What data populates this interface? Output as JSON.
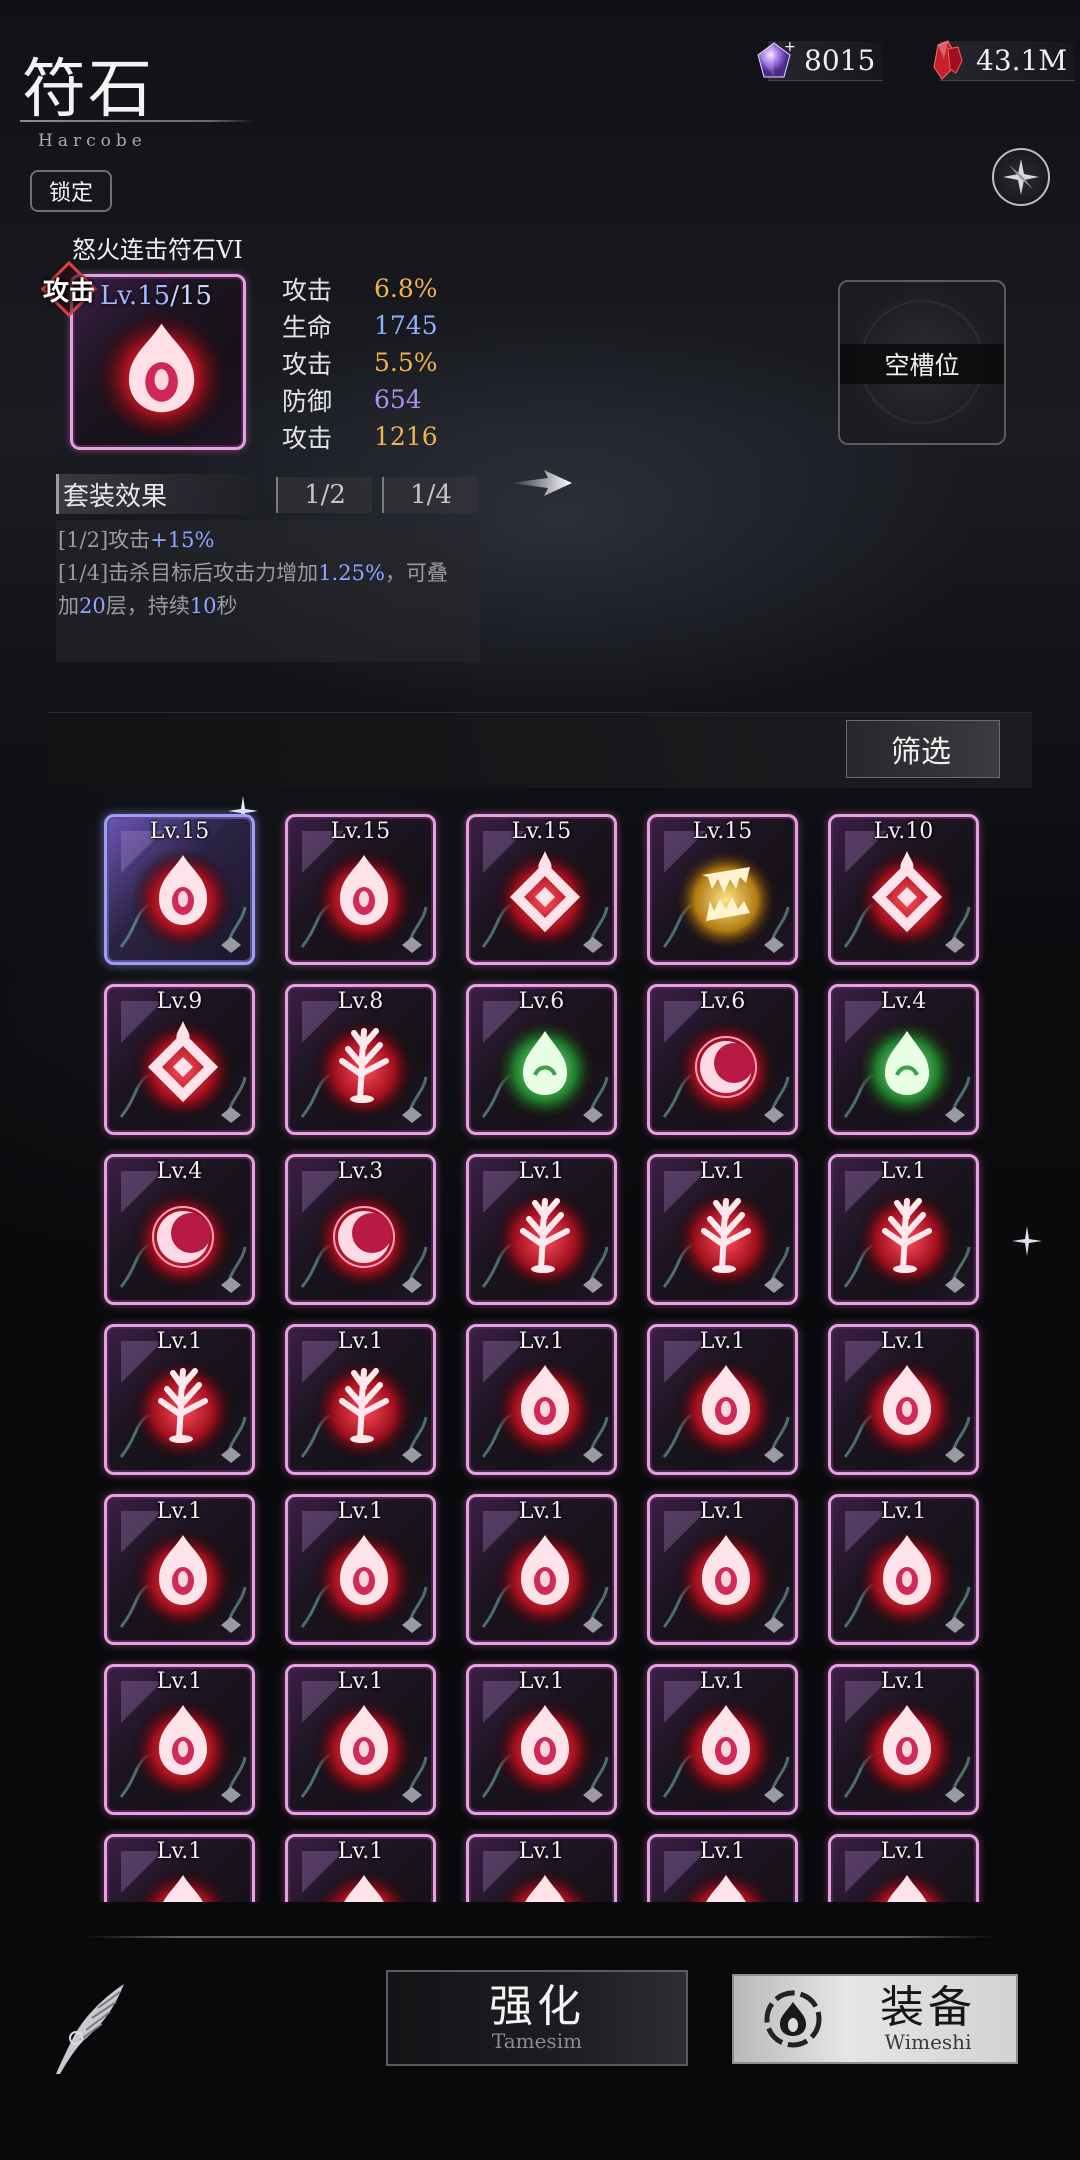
{
  "header": {
    "title": "符石",
    "subtitle": "Harcobe"
  },
  "currency": {
    "gems": "8015",
    "rubies": "43.1M"
  },
  "lock_label": "锁定",
  "selected_rune": {
    "name": "怒火连击符石VI",
    "type_badge": "攻击",
    "level_current": "Lv.15",
    "level_max": "/15",
    "icon": "flame-eye",
    "stats": [
      {
        "label": "攻击",
        "value": "6.8%",
        "color": "#f0b24a"
      },
      {
        "label": "生命",
        "value": "1745",
        "color": "#8fb0ff"
      },
      {
        "label": "攻击",
        "value": "5.5%",
        "color": "#f0b24a"
      },
      {
        "label": "防御",
        "value": "654",
        "color": "#b08cf0"
      },
      {
        "label": "攻击",
        "value": "1216",
        "color": "#f0b24a"
      }
    ]
  },
  "empty_slot_label": "空槽位",
  "set_effect": {
    "header": "套装效果",
    "tabs": [
      "1/2",
      "1/4"
    ],
    "line1_prefix": "[1/2]攻击",
    "line1_value": "+15%",
    "line2_prefix": "[1/4]击杀目标后攻击力增加",
    "line2_value": "1.25%",
    "line2_mid": "，可叠",
    "line3_prefix": "加",
    "line3_value1": "20",
    "line3_mid": "层，持续",
    "line3_value2": "10",
    "line3_suffix": "秒"
  },
  "filter_label": "筛选",
  "runes": [
    {
      "level": "Lv.15",
      "icon": "flame-eye",
      "selected": true
    },
    {
      "level": "Lv.15",
      "icon": "flame-eye"
    },
    {
      "level": "Lv.15",
      "icon": "diamond-flame"
    },
    {
      "level": "Lv.15",
      "icon": "fang-gold"
    },
    {
      "level": "Lv.10",
      "icon": "diamond-flame"
    },
    {
      "level": "Lv.9",
      "icon": "diamond-flame"
    },
    {
      "level": "Lv.8",
      "icon": "tree"
    },
    {
      "level": "Lv.6",
      "icon": "drop-green"
    },
    {
      "level": "Lv.6",
      "icon": "crescent"
    },
    {
      "level": "Lv.4",
      "icon": "drop-green"
    },
    {
      "level": "Lv.4",
      "icon": "crescent"
    },
    {
      "level": "Lv.3",
      "icon": "crescent"
    },
    {
      "level": "Lv.1",
      "icon": "tree"
    },
    {
      "level": "Lv.1",
      "icon": "tree"
    },
    {
      "level": "Lv.1",
      "icon": "tree"
    },
    {
      "level": "Lv.1",
      "icon": "tree"
    },
    {
      "level": "Lv.1",
      "icon": "tree"
    },
    {
      "level": "Lv.1",
      "icon": "flame-eye"
    },
    {
      "level": "Lv.1",
      "icon": "flame-eye"
    },
    {
      "level": "Lv.1",
      "icon": "flame-eye"
    },
    {
      "level": "Lv.1",
      "icon": "flame-eye"
    },
    {
      "level": "Lv.1",
      "icon": "flame-eye"
    },
    {
      "level": "Lv.1",
      "icon": "flame-eye"
    },
    {
      "level": "Lv.1",
      "icon": "flame-eye"
    },
    {
      "level": "Lv.1",
      "icon": "flame-eye"
    },
    {
      "level": "Lv.1",
      "icon": "flame-eye"
    },
    {
      "level": "Lv.1",
      "icon": "flame-eye"
    },
    {
      "level": "Lv.1",
      "icon": "flame-eye"
    },
    {
      "level": "Lv.1",
      "icon": "flame-eye"
    },
    {
      "level": "Lv.1",
      "icon": "flame-eye"
    },
    {
      "level": "Lv.1",
      "icon": "flame-eye"
    },
    {
      "level": "Lv.1",
      "icon": "flame-eye"
    },
    {
      "level": "Lv.1",
      "icon": "flame-eye"
    },
    {
      "level": "Lv.1",
      "icon": "flame-eye"
    },
    {
      "level": "Lv.1",
      "icon": "flame-eye"
    }
  ],
  "buttons": {
    "enhance_label": "强化",
    "enhance_sub": "Tamesim",
    "equip_label": "装备",
    "equip_sub": "Wimeshi"
  }
}
